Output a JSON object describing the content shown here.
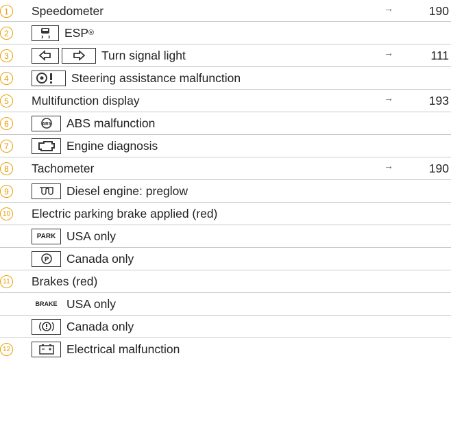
{
  "items": [
    {
      "num": "1",
      "label": "Speedometer",
      "page": "190",
      "arrow": "→"
    },
    {
      "num": "2",
      "icon": "esp-car-skid-icon",
      "label": "ESP",
      "sup": "®"
    },
    {
      "num": "3",
      "icon": "turn-signal-icons",
      "label": "Turn signal light",
      "page": "111",
      "arrow": "→"
    },
    {
      "num": "4",
      "icon": "steering-wheel-warning-icon",
      "label": "Steering assistance malfunction"
    },
    {
      "num": "5",
      "label": "Multifunction display",
      "page": "193",
      "arrow": "→"
    },
    {
      "num": "6",
      "icon": "abs-icon",
      "label": "ABS malfunction"
    },
    {
      "num": "7",
      "icon": "engine-diagnosis-icon",
      "label": "Engine diagnosis"
    },
    {
      "num": "8",
      "label": "Tachometer",
      "page": "190",
      "arrow": "→"
    },
    {
      "num": "9",
      "icon": "preglow-coil-icon",
      "label": "Diesel engine: preglow"
    },
    {
      "num": "10",
      "label": "Electric parking brake applied (red)"
    },
    {
      "icon": "park-text-icon",
      "icon_text": "PARK",
      "label": "USA only"
    },
    {
      "icon": "parking-circle-icon",
      "label": "Canada only"
    },
    {
      "num": "11",
      "label": "Brakes (red)"
    },
    {
      "icon": "brake-text-icon",
      "icon_text": "BRAKE",
      "label": "USA only"
    },
    {
      "icon": "brake-circle-icon",
      "label": "Canada only"
    },
    {
      "num": "12",
      "icon": "battery-icon",
      "label": "Electrical malfunction"
    }
  ]
}
